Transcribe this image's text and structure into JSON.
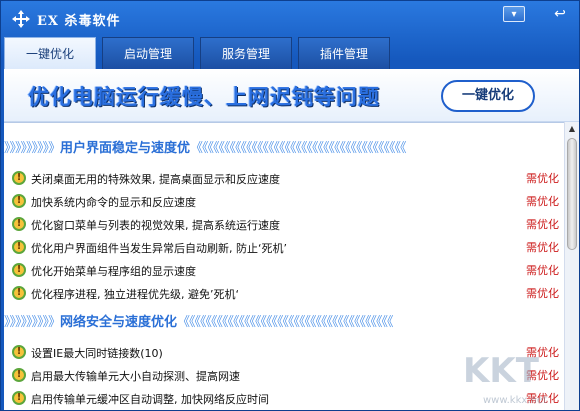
{
  "window": {
    "title": "EX 杀毒软件"
  },
  "titlebar_buttons": [
    {
      "name": "menu-button",
      "icon": "dropdown-icon",
      "glyph": "▾"
    },
    {
      "name": "back-button",
      "icon": "back-arrow-icon",
      "glyph": "↩"
    }
  ],
  "tabs": [
    {
      "label": "一键优化",
      "active": true
    },
    {
      "label": "启动管理",
      "active": false
    },
    {
      "label": "服务管理",
      "active": false
    },
    {
      "label": "插件管理",
      "active": false
    }
  ],
  "banner": {
    "text": "优化电脑运行缓慢、上网迟钝等问题",
    "button_label": "一键优化"
  },
  "sections": [
    {
      "title": "用户界面稳定与速度优",
      "items": [
        {
          "text": "关闭桌面无用的特殊效果, 提高桌面显示和反应速度",
          "status": "需优化"
        },
        {
          "text": "加快系统内命令的显示和反应速度",
          "status": "需优化"
        },
        {
          "text": "优化窗口菜单与列表的视觉效果, 提高系统运行速度",
          "status": "需优化"
        },
        {
          "text": "优化用户界面组件当发生异常后自动刷新, 防止‘死机’",
          "status": "需优化"
        },
        {
          "text": "优化开始菜单与程序组的显示速度",
          "status": "需优化"
        },
        {
          "text": "优化程序进程, 独立进程优先级, 避免’死机‘",
          "status": "需优化"
        }
      ]
    },
    {
      "title": "网络安全与速度优化",
      "items": [
        {
          "text": "设置IE最大同时链接数(10)",
          "status": "需优化"
        },
        {
          "text": "启用最大传输单元大小自动探测、提高网速",
          "status": "需优化"
        },
        {
          "text": "启用传输单元缓冲区自动调整, 加快网络反应时间",
          "status": "需优化"
        }
      ]
    }
  ],
  "chevrons": {
    "left": "》》》》》》》》》",
    "right": "《《《《《《《《《《《《《《《《《《《《《《《《《《《《《《《《《《《《《《"
  },
  "watermark": {
    "text": "KKT",
    "url": "www.kkx.net"
  },
  "colors": {
    "accent": "#1b63c7",
    "status_red": "#cc1a1a",
    "section_blue": "#2a6fd6"
  }
}
